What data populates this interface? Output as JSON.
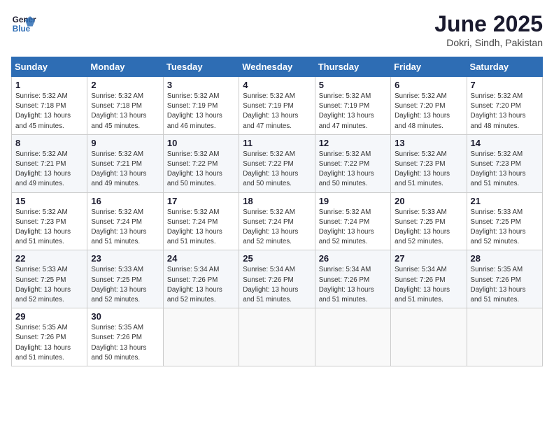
{
  "logo": {
    "line1": "General",
    "line2": "Blue"
  },
  "title": "June 2025",
  "subtitle": "Dokri, Sindh, Pakistan",
  "weekdays": [
    "Sunday",
    "Monday",
    "Tuesday",
    "Wednesday",
    "Thursday",
    "Friday",
    "Saturday"
  ],
  "weeks": [
    [
      {
        "day": "1",
        "info": "Sunrise: 5:32 AM\nSunset: 7:18 PM\nDaylight: 13 hours\nand 45 minutes."
      },
      {
        "day": "2",
        "info": "Sunrise: 5:32 AM\nSunset: 7:18 PM\nDaylight: 13 hours\nand 45 minutes."
      },
      {
        "day": "3",
        "info": "Sunrise: 5:32 AM\nSunset: 7:19 PM\nDaylight: 13 hours\nand 46 minutes."
      },
      {
        "day": "4",
        "info": "Sunrise: 5:32 AM\nSunset: 7:19 PM\nDaylight: 13 hours\nand 47 minutes."
      },
      {
        "day": "5",
        "info": "Sunrise: 5:32 AM\nSunset: 7:19 PM\nDaylight: 13 hours\nand 47 minutes."
      },
      {
        "day": "6",
        "info": "Sunrise: 5:32 AM\nSunset: 7:20 PM\nDaylight: 13 hours\nand 48 minutes."
      },
      {
        "day": "7",
        "info": "Sunrise: 5:32 AM\nSunset: 7:20 PM\nDaylight: 13 hours\nand 48 minutes."
      }
    ],
    [
      {
        "day": "8",
        "info": "Sunrise: 5:32 AM\nSunset: 7:21 PM\nDaylight: 13 hours\nand 49 minutes."
      },
      {
        "day": "9",
        "info": "Sunrise: 5:32 AM\nSunset: 7:21 PM\nDaylight: 13 hours\nand 49 minutes."
      },
      {
        "day": "10",
        "info": "Sunrise: 5:32 AM\nSunset: 7:22 PM\nDaylight: 13 hours\nand 50 minutes."
      },
      {
        "day": "11",
        "info": "Sunrise: 5:32 AM\nSunset: 7:22 PM\nDaylight: 13 hours\nand 50 minutes."
      },
      {
        "day": "12",
        "info": "Sunrise: 5:32 AM\nSunset: 7:22 PM\nDaylight: 13 hours\nand 50 minutes."
      },
      {
        "day": "13",
        "info": "Sunrise: 5:32 AM\nSunset: 7:23 PM\nDaylight: 13 hours\nand 51 minutes."
      },
      {
        "day": "14",
        "info": "Sunrise: 5:32 AM\nSunset: 7:23 PM\nDaylight: 13 hours\nand 51 minutes."
      }
    ],
    [
      {
        "day": "15",
        "info": "Sunrise: 5:32 AM\nSunset: 7:23 PM\nDaylight: 13 hours\nand 51 minutes."
      },
      {
        "day": "16",
        "info": "Sunrise: 5:32 AM\nSunset: 7:24 PM\nDaylight: 13 hours\nand 51 minutes."
      },
      {
        "day": "17",
        "info": "Sunrise: 5:32 AM\nSunset: 7:24 PM\nDaylight: 13 hours\nand 51 minutes."
      },
      {
        "day": "18",
        "info": "Sunrise: 5:32 AM\nSunset: 7:24 PM\nDaylight: 13 hours\nand 52 minutes."
      },
      {
        "day": "19",
        "info": "Sunrise: 5:32 AM\nSunset: 7:24 PM\nDaylight: 13 hours\nand 52 minutes."
      },
      {
        "day": "20",
        "info": "Sunrise: 5:33 AM\nSunset: 7:25 PM\nDaylight: 13 hours\nand 52 minutes."
      },
      {
        "day": "21",
        "info": "Sunrise: 5:33 AM\nSunset: 7:25 PM\nDaylight: 13 hours\nand 52 minutes."
      }
    ],
    [
      {
        "day": "22",
        "info": "Sunrise: 5:33 AM\nSunset: 7:25 PM\nDaylight: 13 hours\nand 52 minutes."
      },
      {
        "day": "23",
        "info": "Sunrise: 5:33 AM\nSunset: 7:25 PM\nDaylight: 13 hours\nand 52 minutes."
      },
      {
        "day": "24",
        "info": "Sunrise: 5:34 AM\nSunset: 7:26 PM\nDaylight: 13 hours\nand 52 minutes."
      },
      {
        "day": "25",
        "info": "Sunrise: 5:34 AM\nSunset: 7:26 PM\nDaylight: 13 hours\nand 51 minutes."
      },
      {
        "day": "26",
        "info": "Sunrise: 5:34 AM\nSunset: 7:26 PM\nDaylight: 13 hours\nand 51 minutes."
      },
      {
        "day": "27",
        "info": "Sunrise: 5:34 AM\nSunset: 7:26 PM\nDaylight: 13 hours\nand 51 minutes."
      },
      {
        "day": "28",
        "info": "Sunrise: 5:35 AM\nSunset: 7:26 PM\nDaylight: 13 hours\nand 51 minutes."
      }
    ],
    [
      {
        "day": "29",
        "info": "Sunrise: 5:35 AM\nSunset: 7:26 PM\nDaylight: 13 hours\nand 51 minutes."
      },
      {
        "day": "30",
        "info": "Sunrise: 5:35 AM\nSunset: 7:26 PM\nDaylight: 13 hours\nand 50 minutes."
      },
      {
        "day": "",
        "info": ""
      },
      {
        "day": "",
        "info": ""
      },
      {
        "day": "",
        "info": ""
      },
      {
        "day": "",
        "info": ""
      },
      {
        "day": "",
        "info": ""
      }
    ]
  ]
}
